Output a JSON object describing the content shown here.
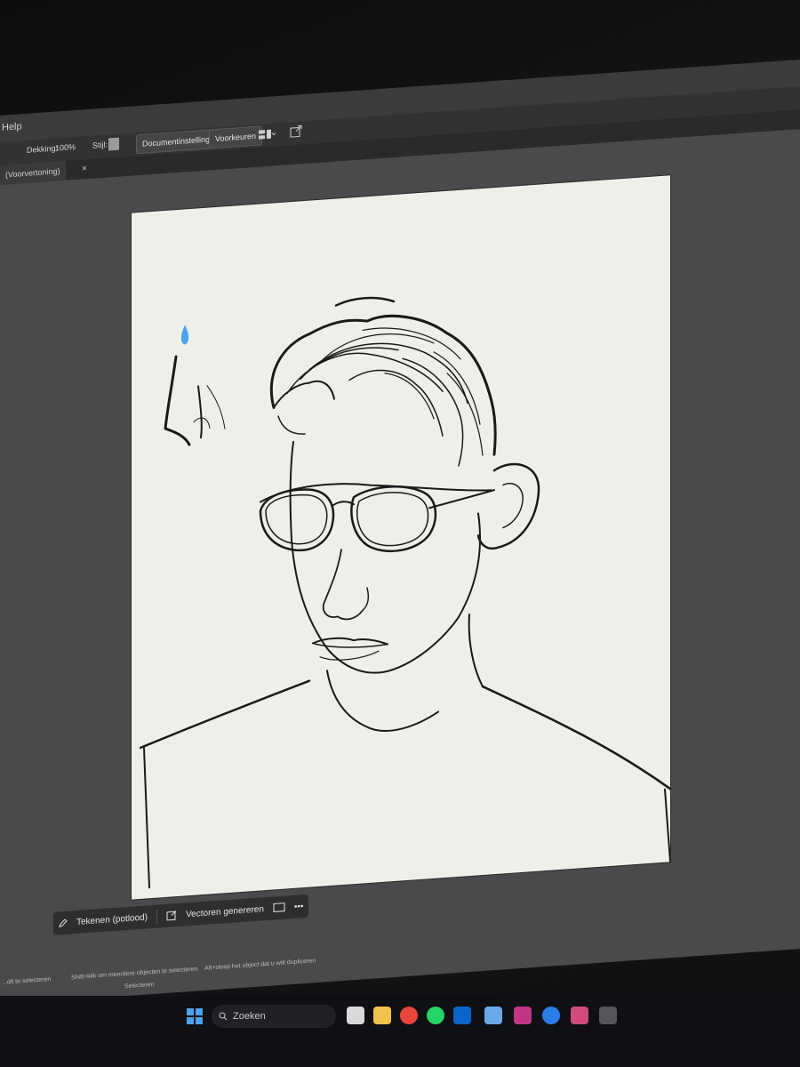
{
  "menubar": {
    "help_label": "Help"
  },
  "control_bar": {
    "opacity_label": "Dekking:",
    "opacity_value": "100%",
    "style_label": "Stijl:",
    "document_settings_button": "Documentinstellingen",
    "preferences_button": "Voorkeuren"
  },
  "document_tab": {
    "label": "(Voorvertoning)",
    "close": "×"
  },
  "contextual_taskbar": {
    "draw_button": "Tekenen (potlood)",
    "vectorize_button": "Vectoren genereren",
    "more_label": "•••"
  },
  "status_bar": {
    "hint1": "...dit te selecteren",
    "hint2": "Shift+klik om meerdere objecten te selecteren",
    "hint3": "Alt+sleep het object dat u wilt dupliceren",
    "tool": "Selecteren"
  },
  "taskbar": {
    "search_placeholder": "Zoeken"
  },
  "colors": {
    "accent_blue": "#4aa3f0",
    "ui_dark": "#323234",
    "artboard": "#efefea"
  }
}
